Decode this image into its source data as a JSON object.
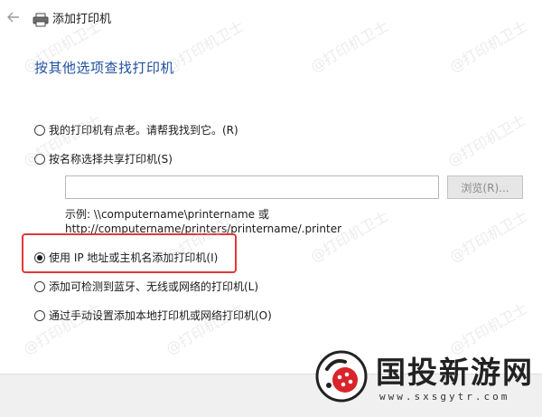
{
  "window": {
    "title": "添加打印机",
    "back_icon": "back-arrow-icon",
    "printer_icon": "printer-icon"
  },
  "heading": "按其他选项查找打印机",
  "options": [
    {
      "label": "我的打印机有点老。请帮我找到它。(R)",
      "checked": false
    },
    {
      "label": "按名称选择共享打印机(S)",
      "checked": false
    },
    {
      "label": "使用 IP 地址或主机名添加打印机(I)",
      "checked": true
    },
    {
      "label": "添加可检测到蓝牙、无线或网络的打印机(L)",
      "checked": false
    },
    {
      "label": "通过手动设置添加本地打印机或网络打印机(O)",
      "checked": false
    }
  ],
  "shared_printer": {
    "input_value": "",
    "browse_label": "浏览(R)...",
    "example_line1": "示例: \\\\computername\\printername 或",
    "example_line2": "http://computername/printers/printername/.printer"
  },
  "watermark_text": "@打印机卫士",
  "branding": {
    "name": "国投新游网",
    "url": "www.sxsgytr.com"
  },
  "colors": {
    "heading": "#1f4fa0",
    "highlight": "#e0383b",
    "brand_red": "#d9252a"
  }
}
